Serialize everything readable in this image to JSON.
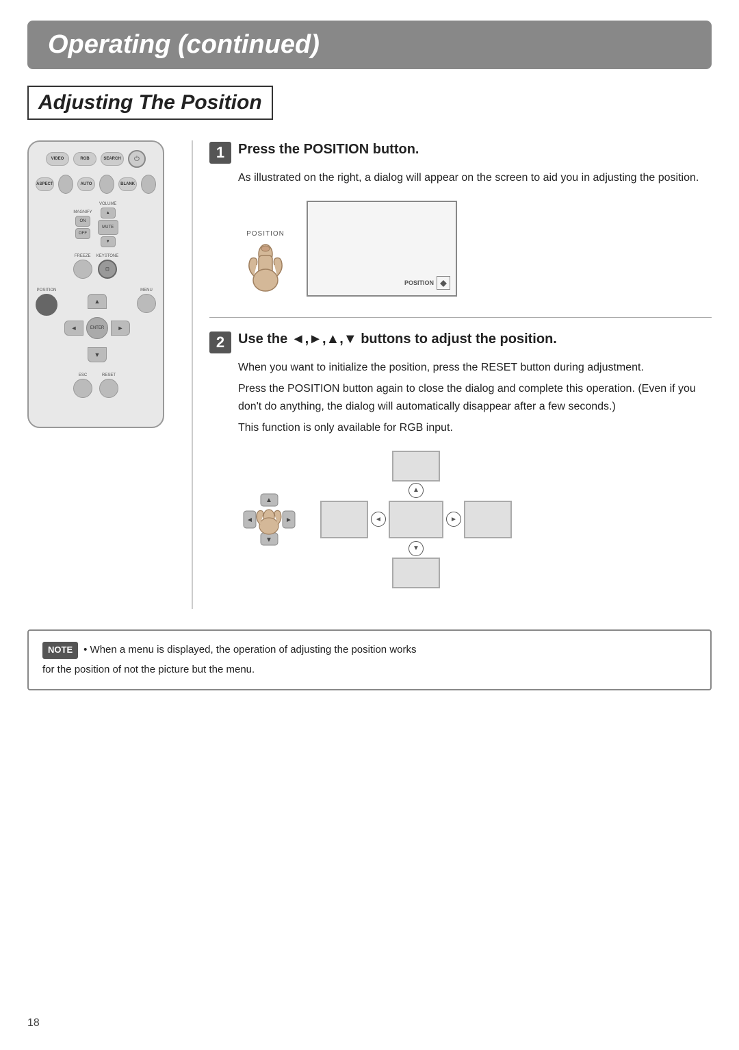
{
  "header": {
    "title": "Operating (continued)"
  },
  "section": {
    "title": "Adjusting The Position"
  },
  "step1": {
    "number": "1",
    "title": "Press the POSITION button.",
    "body": "As illustrated on the right, a dialog will appear on the screen to aid you in adjusting the position.",
    "position_label": "POSITION",
    "screen_position_label": "POSITION"
  },
  "step2": {
    "number": "2",
    "title": "Use the ◄,►,▲,▼ buttons to adjust the position.",
    "body1": "When you want to initialize the position, press the RESET button during adjustment.",
    "body2": "Press the POSITION button again to close the dialog and complete this operation. (Even if you don't do anything, the dialog will automatically disappear after a few seconds.)",
    "body3": "This function is only available for RGB input."
  },
  "note": {
    "badge": "NOTE",
    "text1": "• When a menu is displayed, the operation of adjusting the position works",
    "text2": "for the position of not the picture but the menu."
  },
  "remote": {
    "labels": {
      "video": "VIDEO",
      "rgb": "RGB",
      "search": "SEARCH",
      "aspect": "ASPECT",
      "auto": "AUTO",
      "blank": "BLANK",
      "magnify": "MAGNIFY",
      "volume": "VOLUME",
      "on": "ON",
      "off": "OFF",
      "mute": "MUTE",
      "freeze": "FREEZE",
      "keystone": "KEYSTONE",
      "position": "POSITION",
      "menu": "MENU",
      "enter": "ENTER",
      "esc": "ESC",
      "reset": "RESET"
    }
  },
  "page_number": "18"
}
